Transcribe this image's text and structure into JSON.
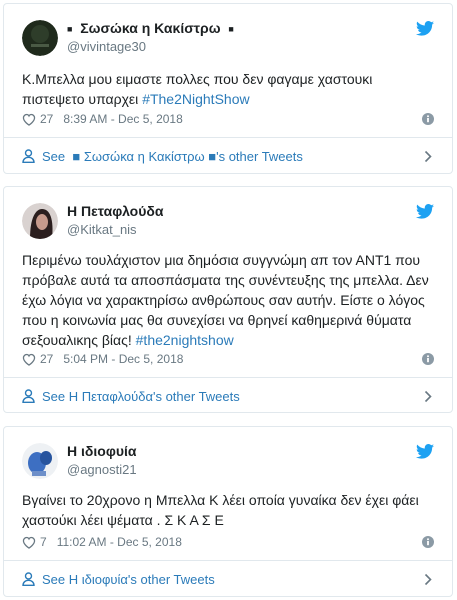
{
  "tweets": [
    {
      "display_name_prefix": "■",
      "display_name": "Σωσώκα η Κακίστρω",
      "display_name_suffix": "■",
      "handle": "@vivintage30",
      "text_before": "Κ.Μπελλα μου ειμαστε πολλες που δεν φαγαμε χαστουκι πιστεψετο υπαρχει ",
      "hashtag": "#The2NightShow",
      "text_after": "",
      "likes": "27",
      "timestamp": "8:39 AM - Dec 5, 2018",
      "footer_see": "See",
      "footer_name": "■ Σωσώκα η Κακίστρω ■",
      "footer_suffix": "'s other Tweets"
    },
    {
      "display_name": "Η Πεταφλούδα",
      "handle": "@Kitkat_nis",
      "text_before": "Περιμένω τουλάχιστον μια δημόσια συγγνώμη απ τον ΑΝΤ1 που πρόβαλε αυτά τα αποσπάσματα της συνέντευξης της μπελλα. Δεν έχω λόγια να χαρακτηρίσω ανθρώπους σαν αυτήν. Είστε ο λόγος που η κοινωνία μας θα συνεχίσει να θρηνεί καθημερινά θύματα σεξουαλικης βίας! ",
      "hashtag": "#the2nightshow",
      "text_after": "",
      "likes": "27",
      "timestamp": "5:04 PM - Dec 5, 2018",
      "footer_text": "See Η Πεταφλούδα's other Tweets"
    },
    {
      "display_name": "Η ιδιοφυία",
      "handle": "@agnosti21",
      "text_before": "Βγαίνει το 20χρονο η Μπελλα Κ λέει οποία γυναίκα δεν έχει φάει χαστούκι λέει ψέματα . Σ Κ Α Σ Ε",
      "hashtag": "",
      "text_after": "",
      "likes": "7",
      "timestamp": "11:02 AM - Dec 5, 2018",
      "footer_text": "See Η ιδιοφυία's other Tweets"
    }
  ],
  "icons": {
    "like": "heart-icon",
    "info": "info-icon",
    "brand": "twitter-bird-icon",
    "footer": "person-icon",
    "more": "chevron-right-icon"
  },
  "colors": {
    "link": "#2b7bb9",
    "muted": "#697882",
    "text": "#1c2022",
    "border": "#e1e8ed",
    "brand": "#1da1f2"
  }
}
